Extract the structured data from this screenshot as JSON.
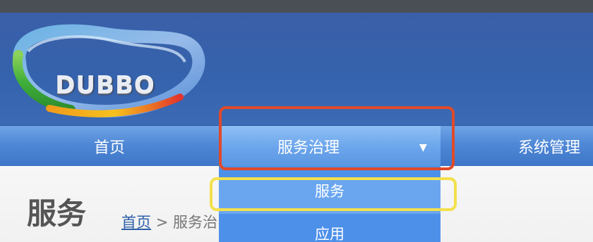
{
  "app": {
    "logo_text": "DUBBO"
  },
  "nav": {
    "items": [
      {
        "label": "首页"
      },
      {
        "label": "服务治理",
        "caret": "▼"
      },
      {
        "label": "系统管理"
      }
    ]
  },
  "dropdown": {
    "items": [
      {
        "label": "服务"
      },
      {
        "label": "应用"
      }
    ]
  },
  "page": {
    "title": "服务",
    "breadcrumb": {
      "home": "首页",
      "separator": ">",
      "current": "服务治"
    }
  },
  "colors": {
    "header_bg": "#3563ad",
    "nav_bg": "#4f88d6",
    "nav_active_bg": "#6aa4eb",
    "dropdown_bg": "#4d90ea",
    "highlight_red": "#e04a2a",
    "highlight_yellow": "#f3e04b"
  }
}
